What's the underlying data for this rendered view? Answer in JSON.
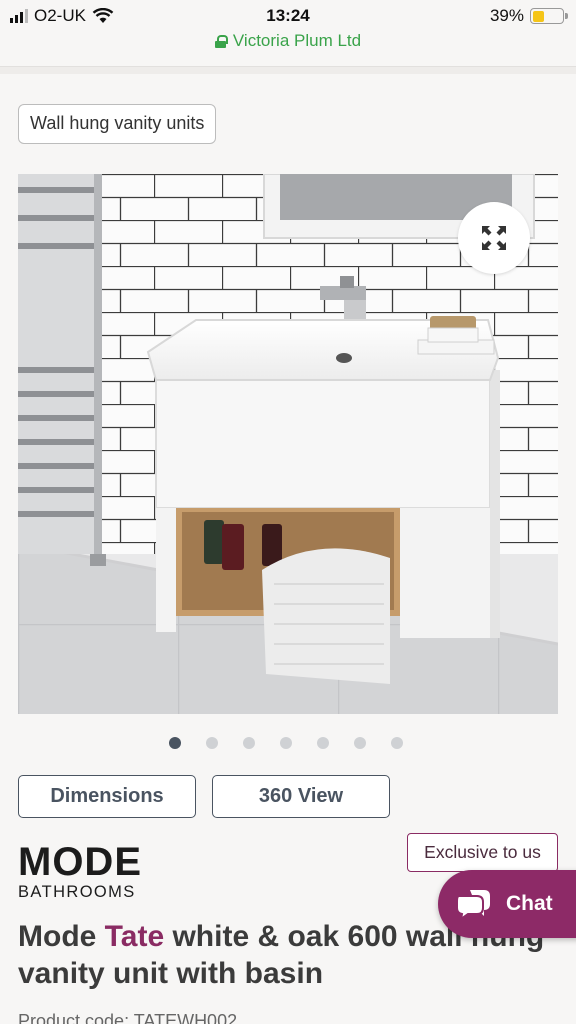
{
  "status_bar": {
    "carrier": "O2-UK",
    "time": "13:24",
    "battery": "39%",
    "battery_level": 0.39,
    "site": "Victoria Plum Ltd"
  },
  "category_chip": "Wall hung vanity units",
  "gallery": {
    "image_count": 7,
    "active_index": 0
  },
  "actions": {
    "dimensions": "Dimensions",
    "view_360": "360 View"
  },
  "brand": {
    "name": "MODE",
    "sub": "BATHROOMS"
  },
  "exclusive": "Exclusive to us",
  "product": {
    "title_prefix": "Mode ",
    "title_accent": "Tate",
    "title_rest": " white & oak 600 wall hung vanity unit with basin",
    "code": "Product code: TATEWH002"
  },
  "chat_label": "Chat",
  "colors": {
    "accent": "#8d2a67",
    "secure_green": "#3aa34a",
    "button_slate": "#4a5461"
  },
  "icons": [
    "signal-icon",
    "wifi-icon",
    "lock-icon",
    "battery-icon",
    "expand-icon",
    "chat-bubble-icon"
  ]
}
